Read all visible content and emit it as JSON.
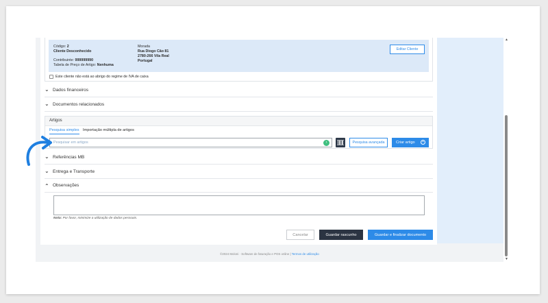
{
  "client": {
    "codigo_label": "Código:",
    "codigo_value": "2",
    "name": "Cliente Desconhecido",
    "contribuinte_label": "Contribuinte:",
    "contribuinte_value": "999999990",
    "tabela_label": "Tabela de Preço de Artigo:",
    "tabela_value": "Nenhuma",
    "morada_label": "Morada",
    "morada_line1": "Rua Diogo Cão 81",
    "morada_line2": "2780-266 Vila Real",
    "morada_line3": "Portugal",
    "edit_button": "Editar Cliente",
    "iva_checkbox_label": "Este cliente não está ao abrigo do regime de IVA de caixa"
  },
  "sections": {
    "dados_financeiros": "Dados financeiros",
    "documentos_relacionados": "Documentos relacionados",
    "referencias_mb": "Referências MB",
    "entrega_transporte": "Entrega e Transporte",
    "observacoes": "Observações"
  },
  "artigos": {
    "title": "Artigos",
    "tabs": [
      "Pesquisa simples",
      "Importação múltipla de artigos"
    ],
    "search_placeholder": "Pesquisar em artigos",
    "advanced_search": "Pesquisa avançada",
    "create_button": "Criar artigo"
  },
  "observacoes": {
    "note_bold": "Nota:",
    "note_text": "Por favor, minimize a utilização de dados pessoais."
  },
  "actions": {
    "cancel": "Cancelar",
    "save_draft": "Guardar rascunho",
    "save_finalize": "Guardar e finalizar documento"
  },
  "footer": {
    "text": "©2024 Moloni · Software de faturação e POS online |",
    "terms": "Termos de utilização"
  },
  "colors": {
    "accent": "#2d8be8",
    "dark_button": "#2b3442",
    "client_box": "#dce9f8",
    "side_panel": "#e2eefb"
  }
}
